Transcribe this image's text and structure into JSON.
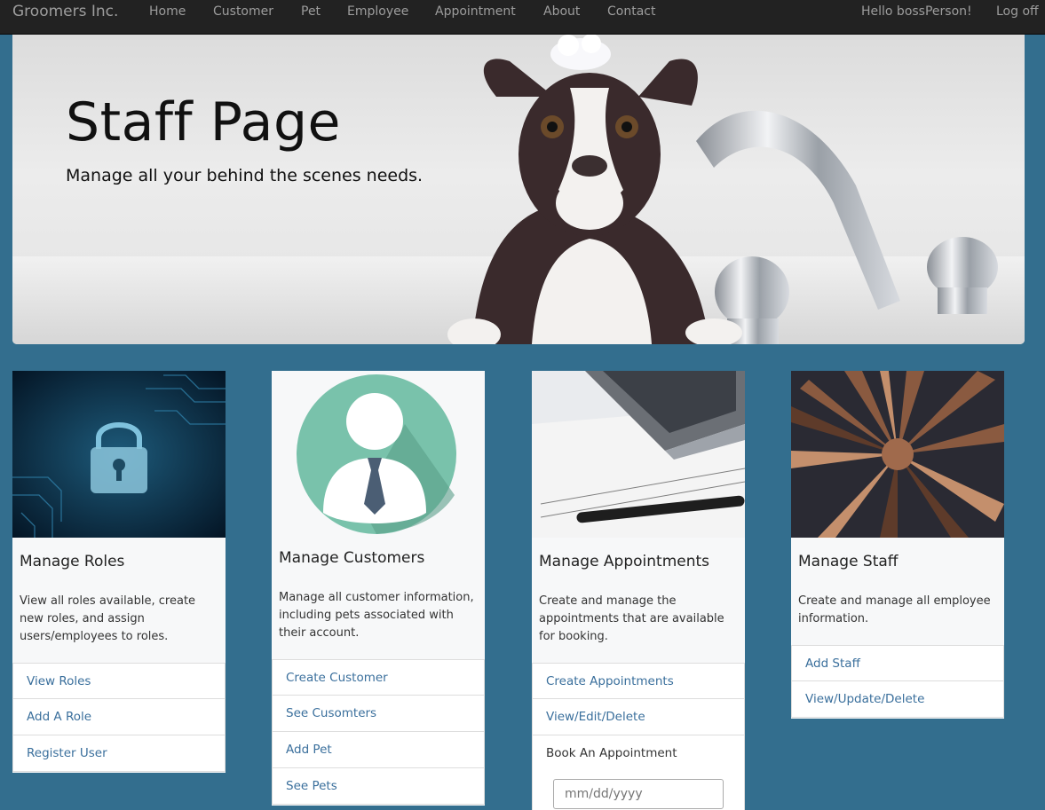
{
  "nav": {
    "brand": "Groomers Inc.",
    "items": [
      "Home",
      "Customer",
      "Pet",
      "Employee",
      "Appointment",
      "About",
      "Contact"
    ],
    "greeting": "Hello bossPerson!",
    "logoff": "Log off"
  },
  "hero": {
    "title": "Staff Page",
    "subtitle": "Manage all your behind the scenes needs."
  },
  "cards": [
    {
      "title": "Manage Roles",
      "text": "View all roles available, create new roles, and assign users/employees to roles.",
      "links": [
        "View Roles",
        "Add A Role",
        "Register User"
      ]
    },
    {
      "title": "Manage Customers",
      "text": "Manage all customer information, including pets associated with their account.",
      "links": [
        "Create Customer",
        "See Cusomters",
        "Add Pet",
        "See Pets"
      ]
    },
    {
      "title": "Manage Appointments",
      "text": "Create and manage the appointments that are available for booking.",
      "links": [
        "Create Appointments",
        "View/Edit/Delete"
      ],
      "book_label": "Book An Appointment",
      "date_placeholder": "mm/dd/yyyy"
    },
    {
      "title": "Manage Staff",
      "text": "Create and manage all employee information.",
      "links": [
        "Add Staff",
        "View/Update/Delete"
      ]
    }
  ],
  "colors": {
    "page_bg": "#336e8e",
    "navbar_bg": "#222222",
    "nav_text": "#9d9d9d",
    "link": "#3a6f9c",
    "card_bg": "#f7f8f9"
  }
}
